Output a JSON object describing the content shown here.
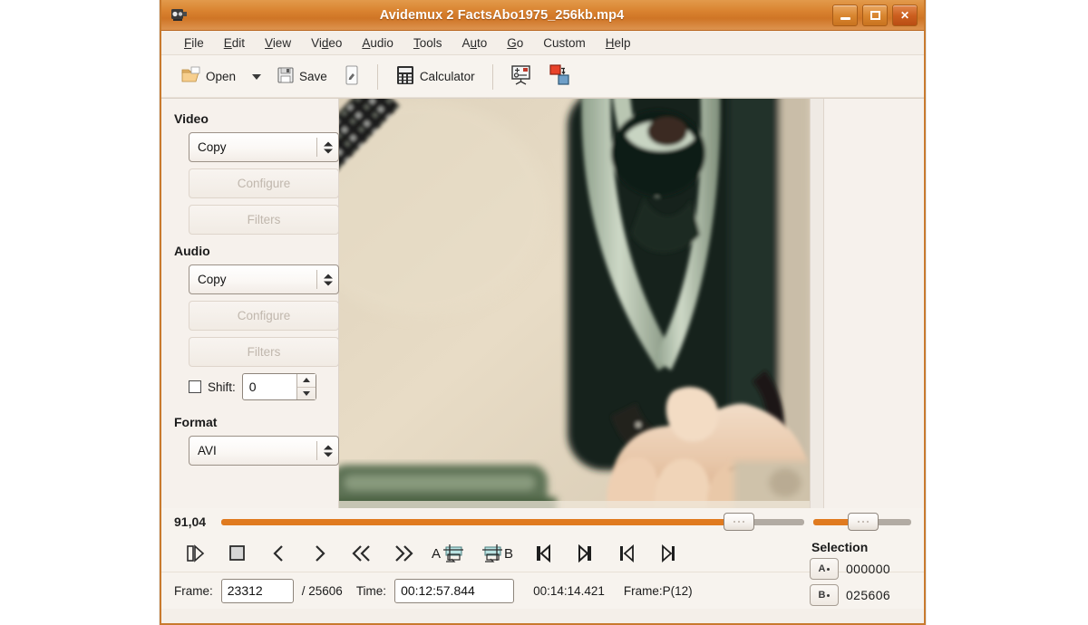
{
  "window": {
    "title": "Avidemux 2 FactsAbo1975_256kb.mp4",
    "app_icon": "avidemux-icon",
    "minimize_label": "–",
    "maximize_label": "□",
    "close_label": "✕"
  },
  "menubar": {
    "items": [
      {
        "label": "File",
        "mnemonic": "F"
      },
      {
        "label": "Edit",
        "mnemonic": "E"
      },
      {
        "label": "View",
        "mnemonic": "V"
      },
      {
        "label": "Video",
        "mnemonic": "d"
      },
      {
        "label": "Audio",
        "mnemonic": "A"
      },
      {
        "label": "Tools",
        "mnemonic": "T"
      },
      {
        "label": "Auto",
        "mnemonic": "u"
      },
      {
        "label": "Go",
        "mnemonic": "G"
      },
      {
        "label": "Custom",
        "mnemonic": "C"
      },
      {
        "label": "Help",
        "mnemonic": "H"
      }
    ]
  },
  "toolbar": {
    "open_label": "Open",
    "open_icon": "folder-open-icon",
    "open_dropdown_icon": "chevron-down-icon",
    "save_label": "Save",
    "save_icon": "floppy-disk-icon",
    "save_as_icon": "save-as-icon",
    "calculator_label": "Calculator",
    "calculator_icon": "calculator-icon",
    "properties_icon": "video-properties-icon",
    "jobs_icon": "job-queue-icon"
  },
  "sidebar": {
    "video": {
      "title": "Video",
      "codec_value": "Copy",
      "configure_label": "Configure",
      "filters_label": "Filters"
    },
    "audio": {
      "title": "Audio",
      "codec_value": "Copy",
      "configure_label": "Configure",
      "filters_label": "Filters",
      "shift_label": "Shift:",
      "shift_value": "0",
      "shift_checked": false
    },
    "format": {
      "title": "Format",
      "value": "AVI"
    }
  },
  "transport": {
    "position_label": "91,04",
    "seek_percent": 91.04,
    "secondary_percent": 52,
    "buttons": [
      {
        "name": "play-pause-button",
        "icon": "play-pause-icon"
      },
      {
        "name": "stop-button",
        "icon": "stop-icon"
      },
      {
        "name": "previous-frame-button",
        "icon": "prev-frame-icon"
      },
      {
        "name": "next-frame-button",
        "icon": "next-frame-icon"
      },
      {
        "name": "fast-rewind-button",
        "icon": "rewind-icon"
      },
      {
        "name": "fast-forward-button",
        "icon": "forward-icon"
      },
      {
        "name": "set-marker-a-button",
        "icon": "marker-a-icon",
        "label": "A"
      },
      {
        "name": "set-marker-b-button",
        "icon": "marker-b-icon",
        "label": "B"
      },
      {
        "name": "go-to-start-button",
        "icon": "skip-start-icon"
      },
      {
        "name": "go-to-end-button",
        "icon": "skip-end-icon"
      },
      {
        "name": "previous-keyframe-button",
        "icon": "prev-keyframe-icon"
      },
      {
        "name": "next-keyframe-button",
        "icon": "next-keyframe-icon"
      }
    ]
  },
  "status": {
    "frame_label": "Frame:",
    "frame_value": "23312",
    "frame_total": "/ 25606",
    "time_label": "Time:",
    "time_value": "00:12:57.844",
    "total_time": "00:14:14.421",
    "frame_type": "Frame:P(12)"
  },
  "selection": {
    "title": "Selection",
    "marker_a_icon": "marker-a-icon",
    "marker_b_icon": "marker-b-icon",
    "marker_a_label": "A",
    "marker_b_label": "B",
    "start_value": "000000",
    "end_value": "025606"
  },
  "colors": {
    "titlebar": "#d9822f",
    "accent_orange": "#e07a1f",
    "panel_bg": "#f6f1ec",
    "border": "#c87a2e"
  }
}
